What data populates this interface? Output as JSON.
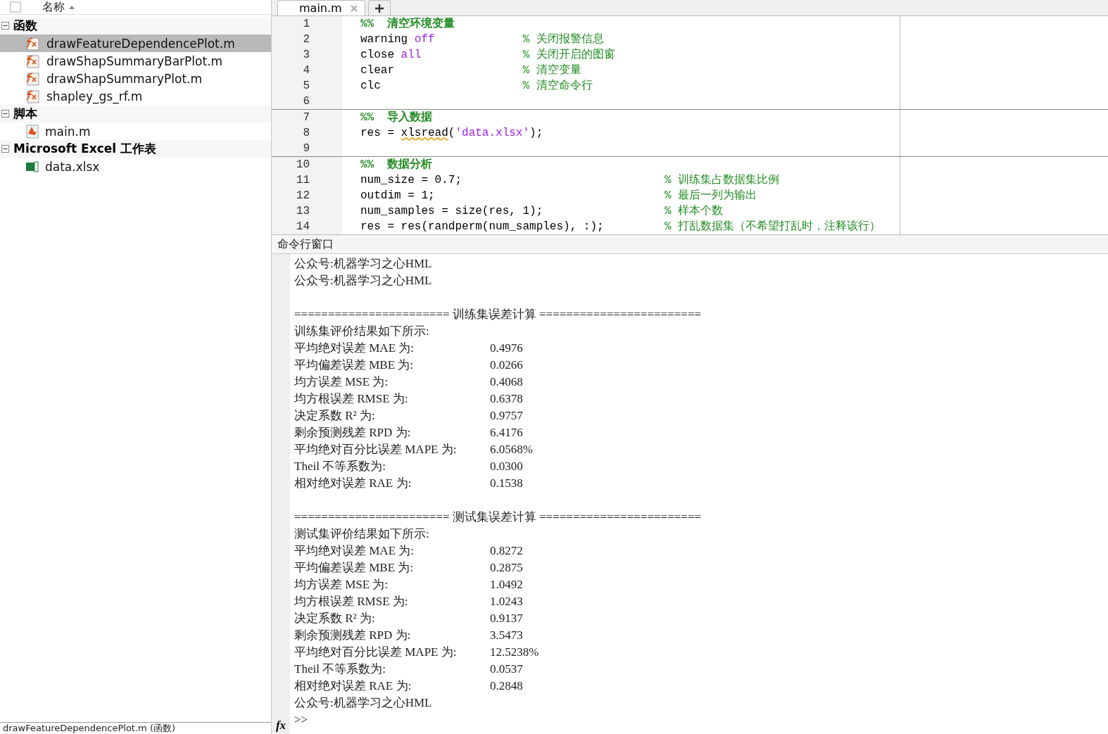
{
  "file_browser": {
    "column_header": "名称",
    "groups": [
      {
        "label": "函数",
        "expanded": true,
        "children": [
          {
            "label": "drawFeatureDependencePlot.m",
            "kind": "function",
            "selected": true
          },
          {
            "label": "drawShapSummaryBarPlot.m",
            "kind": "function",
            "selected": false
          },
          {
            "label": "drawShapSummaryPlot.m",
            "kind": "function",
            "selected": false
          },
          {
            "label": "shapley_gs_rf.m",
            "kind": "function",
            "selected": false
          }
        ]
      },
      {
        "label": "脚本",
        "expanded": true,
        "children": [
          {
            "label": "main.m",
            "kind": "script",
            "selected": false
          }
        ]
      },
      {
        "label": "Microsoft Excel 工作表",
        "expanded": true,
        "children": [
          {
            "label": "data.xlsx",
            "kind": "excel",
            "selected": false
          }
        ]
      }
    ],
    "details_bar": "drawFeatureDependencePlot.m  (函数)"
  },
  "editor": {
    "tabs": [
      {
        "label": "main.m",
        "selected": true
      }
    ],
    "sections": [
      {
        "lines": [
          {
            "number": "1",
            "segments": [
              {
                "kind": "section",
                "text": "%%  清空环境变量"
              }
            ]
          },
          {
            "number": "2",
            "segments": [
              {
                "kind": "code",
                "text": "warning "
              },
              {
                "kind": "keyword",
                "text": "off"
              }
            ],
            "comment": "% 关闭报警信息"
          },
          {
            "number": "3",
            "segments": [
              {
                "kind": "code",
                "text": "close "
              },
              {
                "kind": "keyword",
                "text": "all"
              }
            ],
            "comment": "% 关闭开启的图窗"
          },
          {
            "number": "4",
            "segments": [
              {
                "kind": "code",
                "text": "clear"
              }
            ],
            "comment": "% 清空变量"
          },
          {
            "number": "5",
            "segments": [
              {
                "kind": "code",
                "text": "clc"
              }
            ],
            "comment": "% 清空命令行"
          },
          {
            "number": "6"
          }
        ]
      },
      {
        "lines": [
          {
            "number": "7",
            "segments": [
              {
                "kind": "section",
                "text": "%%  导入数据"
              }
            ]
          },
          {
            "number": "8",
            "segments": [
              {
                "kind": "code",
                "text": "res = "
              },
              {
                "kind": "warning",
                "text": "xlsread"
              },
              {
                "kind": "code",
                "text": "("
              },
              {
                "kind": "string",
                "text": "'data.xlsx'"
              },
              {
                "kind": "code",
                "text": ");"
              }
            ]
          },
          {
            "number": "9"
          }
        ]
      },
      {
        "lines": [
          {
            "number": "10",
            "segments": [
              {
                "kind": "section",
                "text": "%%  数据分析"
              }
            ]
          },
          {
            "number": "11",
            "segments": [
              {
                "kind": "code",
                "text": "num_size = 0.7;"
              }
            ],
            "comment": "% 训练集占数据集比例"
          },
          {
            "number": "12",
            "segments": [
              {
                "kind": "code",
                "text": "outdim = 1;"
              }
            ],
            "comment": "% 最后一列为输出"
          },
          {
            "number": "13",
            "segments": [
              {
                "kind": "code",
                "text": "num_samples = size(res, 1);"
              }
            ],
            "comment": "% 样本个数"
          },
          {
            "number": "14",
            "segments": [
              {
                "kind": "code",
                "text": "res = res(randperm(num_samples), :);"
              }
            ],
            "comment": "% 打乱数据集（不希望打乱时，注释该行）"
          }
        ]
      }
    ]
  },
  "command_window": {
    "title": "命令行窗口",
    "lines": [
      {
        "kind": "text",
        "text": "公众号:机器学习之心HML"
      },
      {
        "kind": "text",
        "text": "公众号:机器学习之心HML"
      },
      {
        "kind": "blank"
      },
      {
        "kind": "text",
        "text": "======================= 训练集误差计算 ========================"
      },
      {
        "kind": "text",
        "text": "训练集评价结果如下所示:"
      },
      {
        "kind": "metric",
        "label": "平均绝对误差 MAE 为:",
        "value": "0.4976"
      },
      {
        "kind": "metric",
        "label": "平均偏差误差 MBE 为:",
        "value": "0.0266"
      },
      {
        "kind": "metric",
        "label": "均方误差 MSE 为:",
        "value": "0.4068"
      },
      {
        "kind": "metric",
        "label": "均方根误差 RMSE 为:",
        "value": "0.6378"
      },
      {
        "kind": "metric",
        "label": "决定系数 R² 为:",
        "value": "0.9757"
      },
      {
        "kind": "metric",
        "label": "剩余预测残差 RPD 为:",
        "value": "6.4176"
      },
      {
        "kind": "metric",
        "label": "平均绝对百分比误差 MAPE 为:",
        "value": "6.0568%"
      },
      {
        "kind": "metric",
        "label": "Theil 不等系数为:",
        "value": "0.0300"
      },
      {
        "kind": "metric",
        "label": "相对绝对误差 RAE 为:",
        "value": "0.1538"
      },
      {
        "kind": "blank"
      },
      {
        "kind": "text",
        "text": "======================= 测试集误差计算 ========================"
      },
      {
        "kind": "text",
        "text": "测试集评价结果如下所示:"
      },
      {
        "kind": "metric",
        "label": "平均绝对误差 MAE 为:",
        "value": "0.8272"
      },
      {
        "kind": "metric",
        "label": "平均偏差误差 MBE 为:",
        "value": "0.2875"
      },
      {
        "kind": "metric",
        "label": "均方误差 MSE 为:",
        "value": "1.0492"
      },
      {
        "kind": "metric",
        "label": "均方根误差 RMSE 为:",
        "value": "1.0243"
      },
      {
        "kind": "metric",
        "label": "决定系数 R² 为:",
        "value": "0.9137"
      },
      {
        "kind": "metric",
        "label": "剩余预测残差 RPD 为:",
        "value": "3.5473"
      },
      {
        "kind": "metric",
        "label": "平均绝对百分比误差 MAPE 为:",
        "value": "12.5238%"
      },
      {
        "kind": "metric",
        "label": "Theil 不等系数为:",
        "value": "0.0537"
      },
      {
        "kind": "metric",
        "label": "相对绝对误差 RAE 为:",
        "value": "0.2848"
      },
      {
        "kind": "text",
        "text": "公众号:机器学习之心HML"
      }
    ],
    "prompt_icon": "fx",
    "prompt": ">>"
  }
}
